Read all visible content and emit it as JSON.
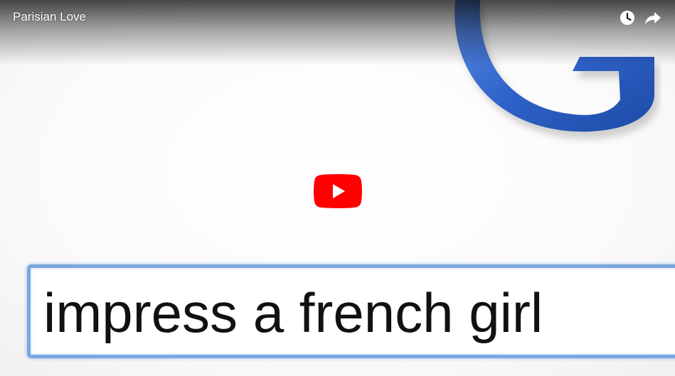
{
  "video": {
    "title": "Parisian Love",
    "thumbnail_query": "impress a french girl"
  },
  "icons": {
    "watch_later": "clock-icon",
    "share": "share-arrow-icon",
    "play": "play-icon",
    "logo": "google-g-logo"
  },
  "colors": {
    "play_red": "#ff0000",
    "search_border": "#7aa7e0",
    "logo_blue": "#3a6fd1"
  }
}
